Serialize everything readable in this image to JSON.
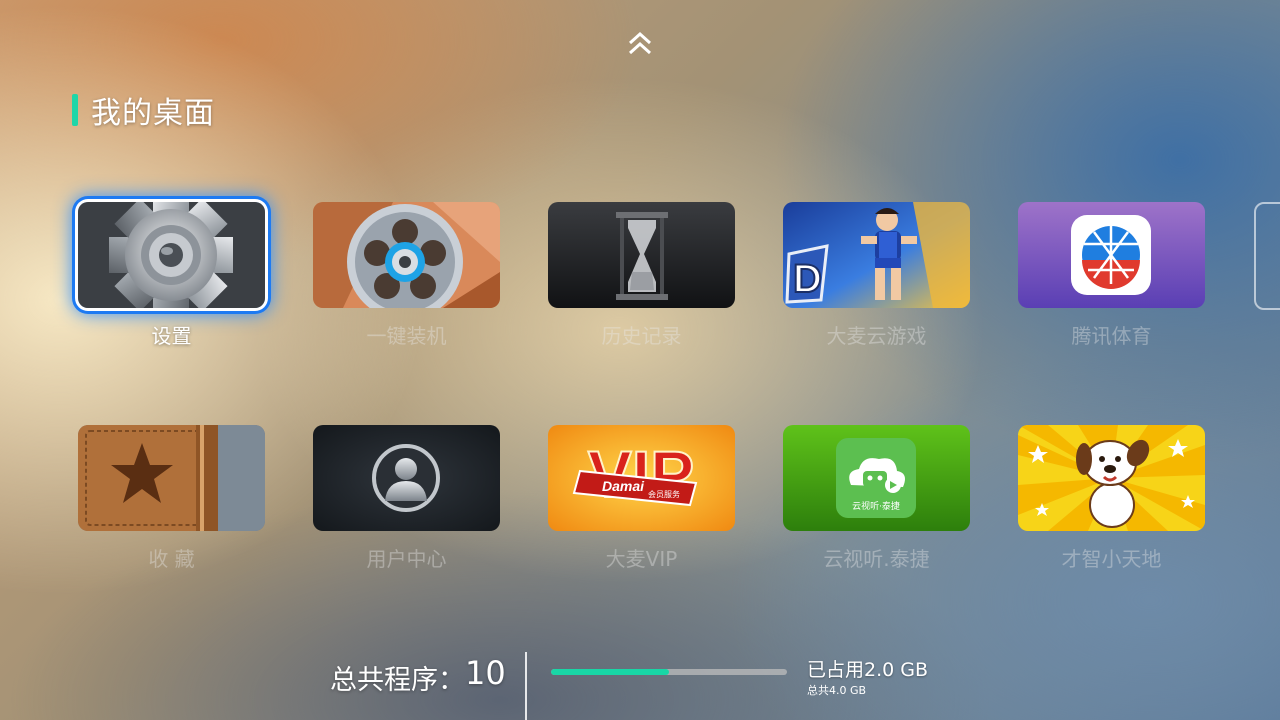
{
  "section_title": "我的桌面",
  "apps": [
    {
      "label": "设置",
      "icon": "gear-icon",
      "focused": true
    },
    {
      "label": "一键装机",
      "icon": "film-reel-icon",
      "focused": false
    },
    {
      "label": "历史记录",
      "icon": "hourglass-icon",
      "focused": false
    },
    {
      "label": "大麦云游戏",
      "icon": "game-character-icon",
      "focused": false
    },
    {
      "label": "腾讯体育",
      "icon": "sports-ball-icon",
      "focused": false
    },
    {
      "label": "收 藏",
      "icon": "star-book-icon",
      "focused": false
    },
    {
      "label": "用户中心",
      "icon": "user-silhouette-icon",
      "focused": false
    },
    {
      "label": "大麦VIP",
      "icon": "vip-badge-icon",
      "focused": false
    },
    {
      "label": "云视听.泰捷",
      "icon": "cloud-tv-icon",
      "focused": false
    },
    {
      "label": "才智小天地",
      "icon": "cartoon-dog-icon",
      "focused": false
    }
  ],
  "vip_tile": {
    "big_text": "VIP",
    "ribbon_text": "Damai",
    "ribbon_sub": "会员服务"
  },
  "cloud_tile": {
    "caption": "云视听·泰捷"
  },
  "status": {
    "programs_label": "总共程序：",
    "programs_count": "10",
    "used_text": "已占用2.0 GB",
    "total_text": "总共4.0 GB",
    "used_fraction": 0.5
  },
  "colors": {
    "accent": "#19d6a6",
    "focus": "#1d7af2"
  }
}
